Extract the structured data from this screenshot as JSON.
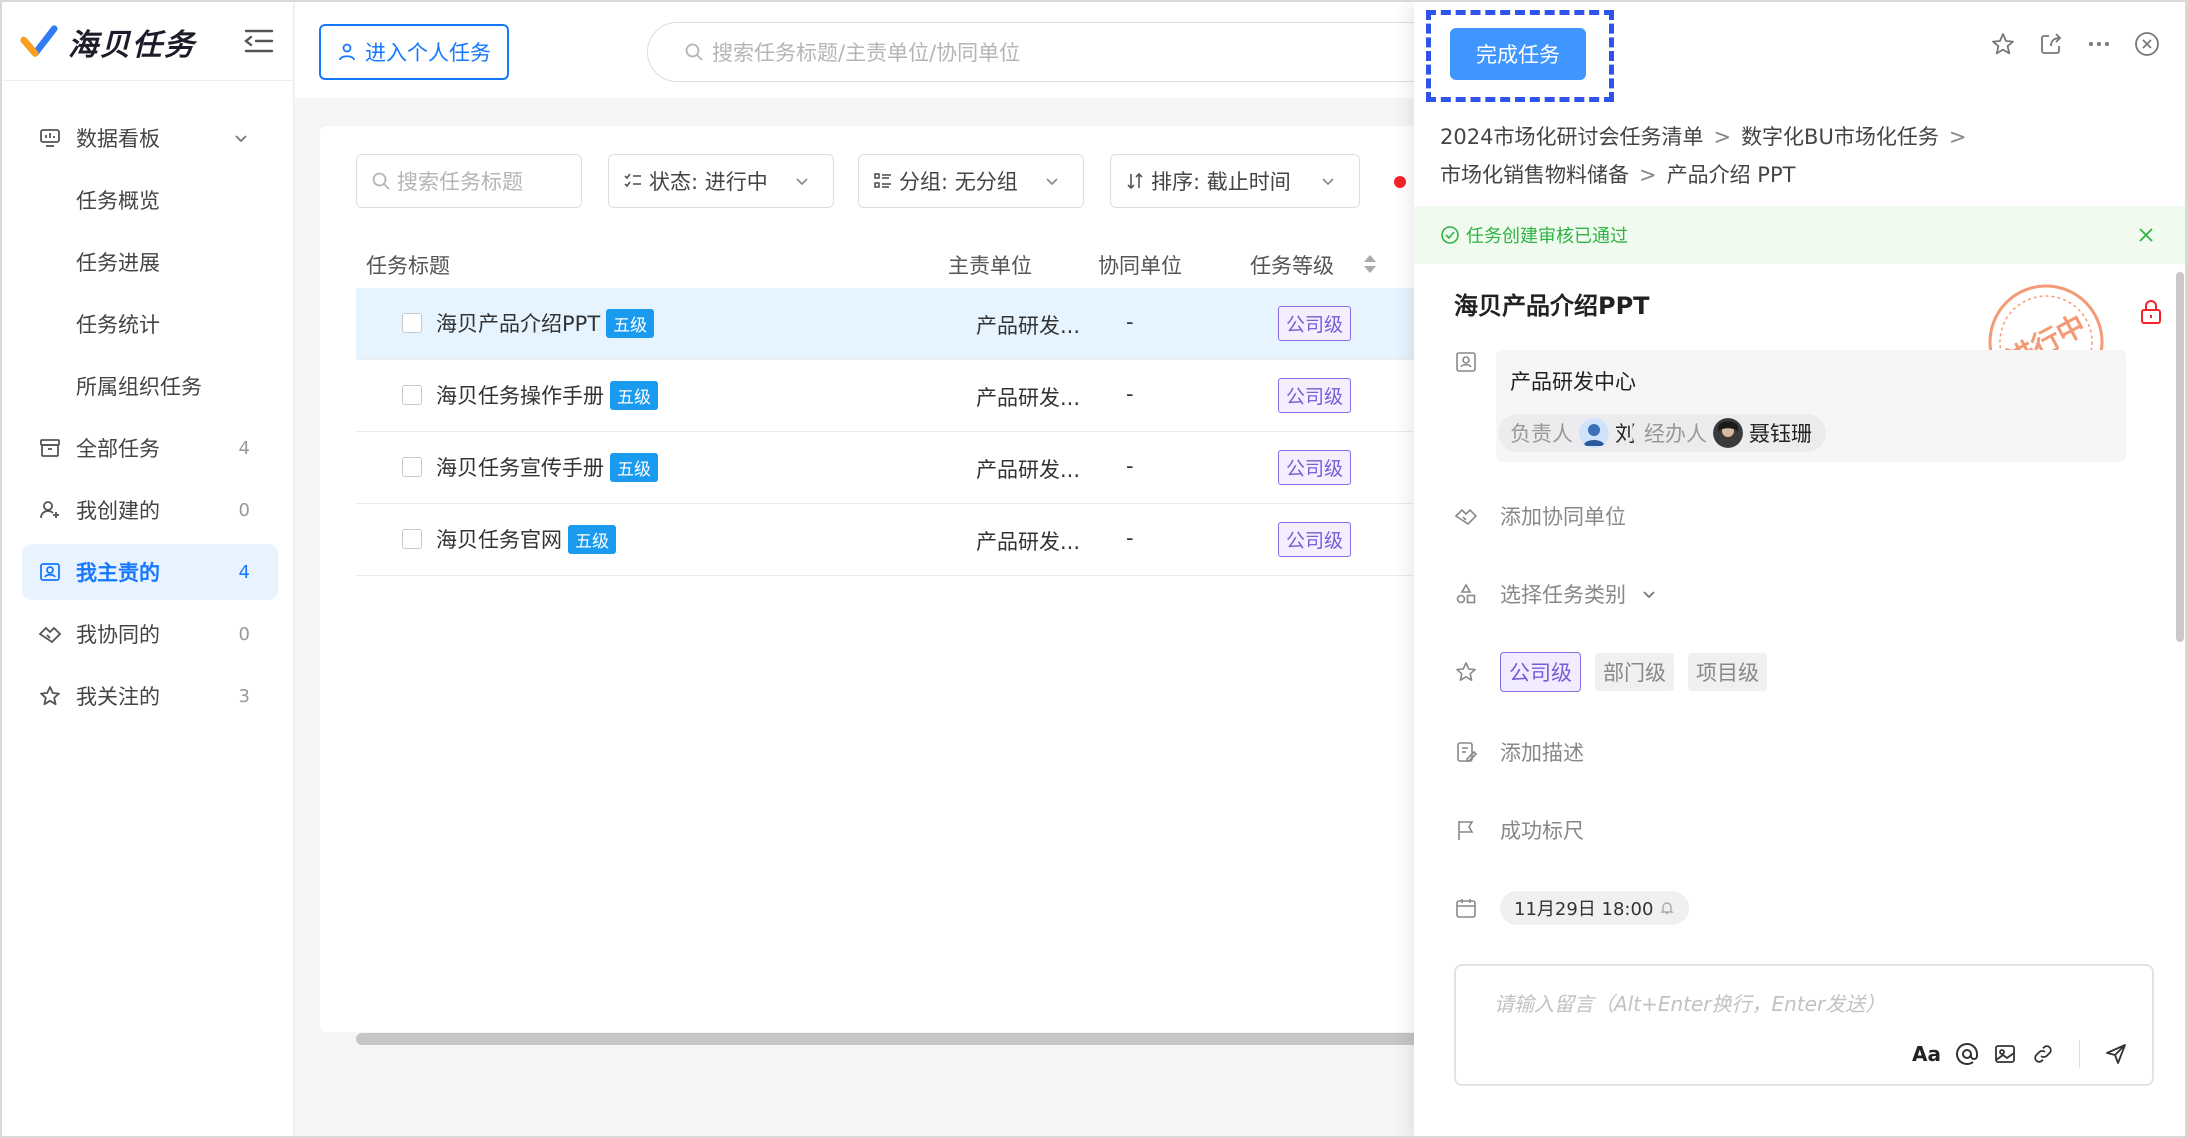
{
  "app": {
    "name": "海贝任务"
  },
  "sidebar": {
    "items": [
      {
        "label": "数据看板",
        "icon": "dashboard-icon"
      },
      {
        "label": "任务概览"
      },
      {
        "label": "任务进展"
      },
      {
        "label": "任务统计"
      },
      {
        "label": "所属组织任务"
      },
      {
        "label": "全部任务",
        "count": "4",
        "icon": "archive-icon"
      },
      {
        "label": "我创建的",
        "count": "0",
        "icon": "user-add-icon"
      },
      {
        "label": "我主责的",
        "count": "4",
        "icon": "badge-icon"
      },
      {
        "label": "我协同的",
        "count": "0",
        "icon": "handshake-icon"
      },
      {
        "label": "我关注的",
        "count": "3",
        "icon": "star-icon"
      }
    ]
  },
  "topbar": {
    "personal_button": "进入个人任务",
    "search_placeholder": "搜索任务标题/主责单位/协同单位"
  },
  "list": {
    "search_placeholder": "搜索任务标题",
    "filters": {
      "status": "状态: 进行中",
      "group": "分组: 无分组",
      "sort": "排序: 截止时间"
    },
    "columns": [
      "任务标题",
      "主责单位",
      "协同单位",
      "任务等级"
    ],
    "rows": [
      {
        "title": "海贝产品介绍PPT",
        "badge": "五级",
        "unit": "产品研发...",
        "co": "-",
        "level": "公司级"
      },
      {
        "title": "海贝任务操作手册",
        "badge": "五级",
        "unit": "产品研发...",
        "co": "-",
        "level": "公司级"
      },
      {
        "title": "海贝任务宣传手册",
        "badge": "五级",
        "unit": "产品研发...",
        "co": "-",
        "level": "公司级"
      },
      {
        "title": "海贝任务官网",
        "badge": "五级",
        "unit": "产品研发...",
        "co": "-",
        "level": "公司级"
      }
    ]
  },
  "detail": {
    "complete_button": "完成任务",
    "breadcrumb": [
      "2024市场化研讨会任务清单",
      "数字化BU市场化任务",
      "市场化销售物料储备",
      "产品介绍 PPT"
    ],
    "notice": "任务创建审核已通过",
    "title": "海贝产品介绍PPT",
    "stamp": "进行中",
    "org": "产品研发中心",
    "owner_role": "负责人",
    "owner_name": "刘滔",
    "handler_role": "经办人",
    "handler_name": "聂钰珊",
    "add_collab": "添加协同单位",
    "select_category": "选择任务类别",
    "levels": [
      "公司级",
      "部门级",
      "项目级"
    ],
    "add_desc": "添加描述",
    "success_ruler": "成功标尺",
    "due": "11月29日 18:00",
    "comment_placeholder": "请输入留言（Alt+Enter换行，Enter发送）",
    "comment_tool_font": "Aa"
  },
  "colors": {
    "primary": "#1677ff",
    "success": "#2fb344",
    "level": "#7a5bd6",
    "stamp": "#f07a4a"
  }
}
